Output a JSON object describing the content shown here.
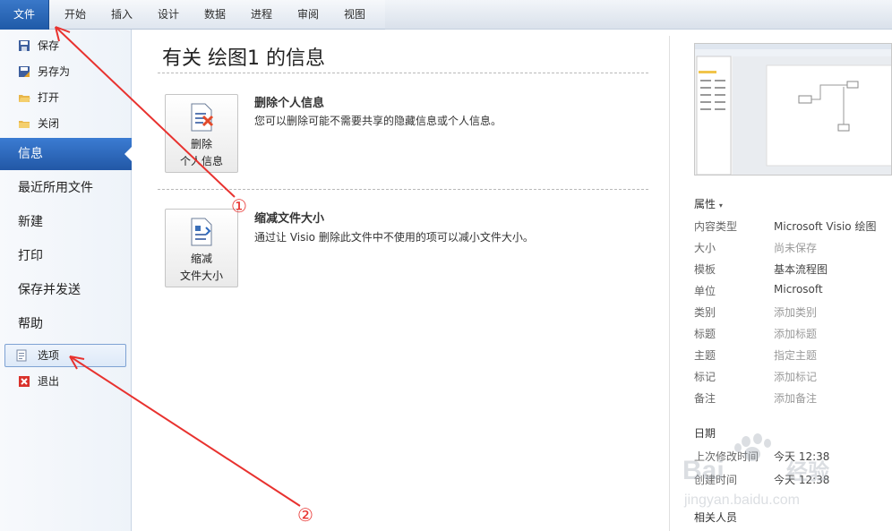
{
  "ribbon": {
    "file_tab": "文件",
    "tabs": [
      "开始",
      "插入",
      "设计",
      "数据",
      "进程",
      "审阅",
      "视图"
    ]
  },
  "leftnav": {
    "commands_top": [
      {
        "label": "保存",
        "icon": "save-icon"
      },
      {
        "label": "另存为",
        "icon": "save-as-icon"
      },
      {
        "label": "打开",
        "icon": "open-folder-icon"
      },
      {
        "label": "关闭",
        "icon": "close-folder-icon"
      }
    ],
    "tabs": [
      {
        "label": "信息",
        "active": true
      },
      {
        "label": "最近所用文件"
      },
      {
        "label": "新建"
      },
      {
        "label": "打印"
      },
      {
        "label": "保存并发送"
      },
      {
        "label": "帮助"
      }
    ],
    "options": {
      "label": "选项",
      "icon": "options-icon"
    },
    "exit": {
      "label": "退出",
      "icon": "exit-icon"
    }
  },
  "main": {
    "title": "有关 绘图1 的信息",
    "remove_personal": {
      "button_line1": "删除",
      "button_line2": "个人信息",
      "heading": "删除个人信息",
      "description": "您可以删除可能不需要共享的隐藏信息或个人信息。"
    },
    "reduce_size": {
      "button_line1": "缩减",
      "button_line2": "文件大小",
      "heading": "缩减文件大小",
      "description": "通过让 Visio 删除此文件中不使用的项可以减小文件大小。"
    }
  },
  "properties": {
    "header": "属性",
    "rows": [
      {
        "key": "内容类型",
        "value": "Microsoft Visio 绘图",
        "placeholder": false
      },
      {
        "key": "大小",
        "value": "尚未保存",
        "placeholder": true
      },
      {
        "key": "模板",
        "value": "基本流程图",
        "placeholder": false
      },
      {
        "key": "单位",
        "value": "Microsoft",
        "placeholder": false
      },
      {
        "key": "类别",
        "value": "添加类别",
        "placeholder": true
      },
      {
        "key": "标题",
        "value": "添加标题",
        "placeholder": true
      },
      {
        "key": "主题",
        "value": "指定主题",
        "placeholder": true
      },
      {
        "key": "标记",
        "value": "添加标记",
        "placeholder": true
      },
      {
        "key": "备注",
        "value": "添加备注",
        "placeholder": true
      }
    ],
    "dates_header": "日期",
    "dates": [
      {
        "key": "上次修改时间",
        "value": "今天 12:38"
      },
      {
        "key": "创建时间",
        "value": "今天 12:38"
      }
    ],
    "people_header": "相关人员"
  },
  "annotations": {
    "marker1": "①",
    "marker2": "②",
    "color": "#e8322f"
  },
  "watermark": {
    "text": "Bai 经验",
    "subtext": "jingyan.baidu.com"
  },
  "colors": {
    "file_tab": "#2a66b8",
    "active_nav": "#2d69bd",
    "annotation": "#e8322f"
  }
}
